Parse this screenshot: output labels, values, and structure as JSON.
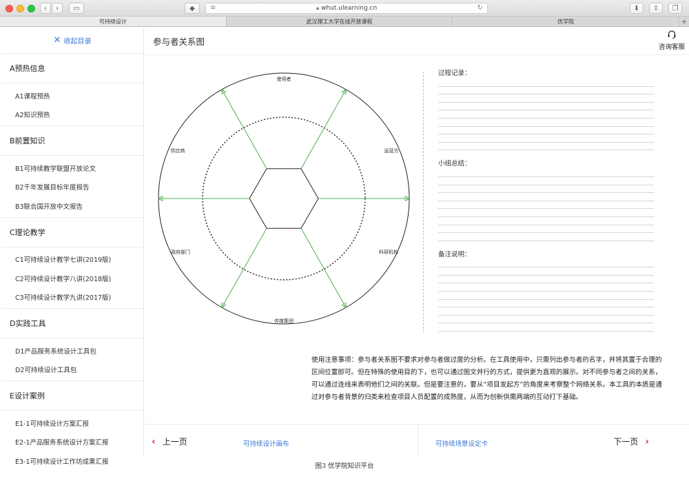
{
  "browser": {
    "url": "whut.ulearning.cn",
    "tabs": [
      "可持续设计",
      "武汉理工大学在线开放课程",
      "优学院"
    ]
  },
  "sidebar": {
    "collapse_label": "收起目录",
    "sections": [
      {
        "title": "A预热信息",
        "items": [
          "A1课程预热",
          "A2知识预热"
        ]
      },
      {
        "title": "B前置知识",
        "items": [
          "B1可持续教学联盟开放论文",
          "B2千年发展目标年度报告",
          "B3联合国开放中文报告"
        ]
      },
      {
        "title": "C理论教学",
        "items": [
          "C1可持续设计教学七讲(2019版)",
          "C2可持续设计教学八讲(2018版)",
          "C3可持续设计教学九讲(2017版)"
        ]
      },
      {
        "title": "D实践工具",
        "items": [
          "D1产品服务系统设计工具包",
          "D2可持续设计工具包"
        ]
      },
      {
        "title": "E设计案例",
        "items": [
          "E1-1可持续设计方案汇报",
          "E2-1产品服务系统设计方案汇报",
          "E3-1可持续设计工作坊成果汇报"
        ]
      }
    ]
  },
  "header": {
    "title": "参与者关系图",
    "support_label": "咨询客服"
  },
  "diagram": {
    "labels": {
      "top": "使用者",
      "top_right": "运营方",
      "bottom_right": "科研机构",
      "bottom": "传媒集团",
      "bottom_left": "政府部门",
      "top_left": "供应商"
    }
  },
  "notes": {
    "process_label": "过程记录：",
    "summary_label": "小组总结：",
    "remark_label": "备注说明："
  },
  "usage_text": "使用注意事项：参与者关系图不要求对参与者做过度的分析。在工具使用中，只需列出参与者的名字，并将其置于合理的区间位置即可。但在特殊的使用目的下，也可以通过图文并行的方式，提供更为直观的展示。对不同参与者之间的关系，可以通过连线来表明他们之间的关联。但是要注意的，要从“项目发起方”的角度来考察整个网络关系。本工具的本质是通过对参与者背景的归类来检查项目人员配置的成熟度，从而为创新供需两端的互动打下基础。",
  "footer": {
    "prev_label": "上一页",
    "prev_link": "可持续设计画布",
    "next_link": "可持续场景设定卡",
    "next_label": "下一页"
  },
  "caption": "图3 优学院知识平台",
  "colors": {
    "accent_blue": "#3b7ad6",
    "arrow_green": "#4caf50",
    "chevron_red": "#d23a3a"
  }
}
